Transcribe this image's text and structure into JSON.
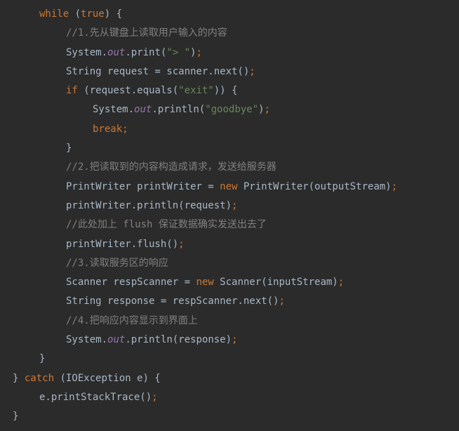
{
  "lines": [
    {
      "indent": 1,
      "tokens": [
        {
          "t": "kw",
          "v": "while"
        },
        {
          "t": "punct",
          "v": " ("
        },
        {
          "t": "kw",
          "v": "true"
        },
        {
          "t": "punct",
          "v": ") {"
        }
      ]
    },
    {
      "indent": 2,
      "tokens": [
        {
          "t": "cmt",
          "v": "//1.先从键盘上读取用户输入的内容"
        }
      ]
    },
    {
      "indent": 2,
      "tokens": [
        {
          "t": "ident",
          "v": "System."
        },
        {
          "t": "field",
          "v": "out"
        },
        {
          "t": "ident",
          "v": ".print("
        },
        {
          "t": "str",
          "v": "\"> \""
        },
        {
          "t": "ident",
          "v": ")"
        },
        {
          "t": "kw",
          "v": ";"
        }
      ]
    },
    {
      "indent": 2,
      "tokens": [
        {
          "t": "ident",
          "v": "String request = scanner.next()"
        },
        {
          "t": "kw",
          "v": ";"
        }
      ]
    },
    {
      "indent": 2,
      "tokens": [
        {
          "t": "kw",
          "v": "if"
        },
        {
          "t": "ident",
          "v": " (request.equals("
        },
        {
          "t": "str",
          "v": "\"exit\""
        },
        {
          "t": "ident",
          "v": ")) {"
        }
      ]
    },
    {
      "indent": 3,
      "tokens": [
        {
          "t": "ident",
          "v": "System."
        },
        {
          "t": "field",
          "v": "out"
        },
        {
          "t": "ident",
          "v": ".println("
        },
        {
          "t": "str",
          "v": "\"goodbye\""
        },
        {
          "t": "ident",
          "v": ")"
        },
        {
          "t": "kw",
          "v": ";"
        }
      ]
    },
    {
      "indent": 3,
      "tokens": [
        {
          "t": "kw",
          "v": "break;"
        }
      ]
    },
    {
      "indent": 2,
      "tokens": [
        {
          "t": "ident",
          "v": "}"
        }
      ]
    },
    {
      "indent": 2,
      "tokens": [
        {
          "t": "cmt",
          "v": "//2.把读取到的内容构造成请求，发送给服务器"
        }
      ]
    },
    {
      "indent": 2,
      "tokens": [
        {
          "t": "ident",
          "v": "PrintWriter printWriter = "
        },
        {
          "t": "kw",
          "v": "new"
        },
        {
          "t": "ident",
          "v": " PrintWriter(outputStream)"
        },
        {
          "t": "kw",
          "v": ";"
        }
      ]
    },
    {
      "indent": 2,
      "tokens": [
        {
          "t": "ident",
          "v": "printWriter.println(request)"
        },
        {
          "t": "kw",
          "v": ";"
        }
      ]
    },
    {
      "indent": 2,
      "tokens": [
        {
          "t": "cmt",
          "v": "//此处加上 flush 保证数据确实发送出去了"
        }
      ]
    },
    {
      "indent": 2,
      "tokens": [
        {
          "t": "ident",
          "v": "printWriter.flush()"
        },
        {
          "t": "kw",
          "v": ";"
        }
      ]
    },
    {
      "indent": 2,
      "tokens": [
        {
          "t": "cmt",
          "v": "//3.读取服务区的响应"
        }
      ]
    },
    {
      "indent": 2,
      "tokens": [
        {
          "t": "ident",
          "v": "Scanner respScanner = "
        },
        {
          "t": "kw",
          "v": "new"
        },
        {
          "t": "ident",
          "v": " Scanner(inputStream)"
        },
        {
          "t": "kw",
          "v": ";"
        }
      ]
    },
    {
      "indent": 2,
      "tokens": [
        {
          "t": "ident",
          "v": "String response = respScanner.next()"
        },
        {
          "t": "kw",
          "v": ";"
        }
      ]
    },
    {
      "indent": 2,
      "tokens": [
        {
          "t": "cmt",
          "v": "//4.把响应内容显示到界面上"
        }
      ]
    },
    {
      "indent": 2,
      "tokens": [
        {
          "t": "ident",
          "v": "System."
        },
        {
          "t": "field",
          "v": "out"
        },
        {
          "t": "ident",
          "v": ".println(response)"
        },
        {
          "t": "kw",
          "v": ";"
        }
      ]
    },
    {
      "indent": 1,
      "tokens": [
        {
          "t": "ident",
          "v": "}"
        }
      ]
    },
    {
      "indent": 0,
      "tokens": [
        {
          "t": "ident",
          "v": "} "
        },
        {
          "t": "kw",
          "v": "catch"
        },
        {
          "t": "ident",
          "v": " (IOException e) {"
        }
      ]
    },
    {
      "indent": 1,
      "tokens": [
        {
          "t": "ident",
          "v": "e.printStackTrace()"
        },
        {
          "t": "kw",
          "v": ";"
        }
      ]
    },
    {
      "indent": 0,
      "tokens": [
        {
          "t": "ident",
          "v": "}"
        }
      ]
    }
  ]
}
